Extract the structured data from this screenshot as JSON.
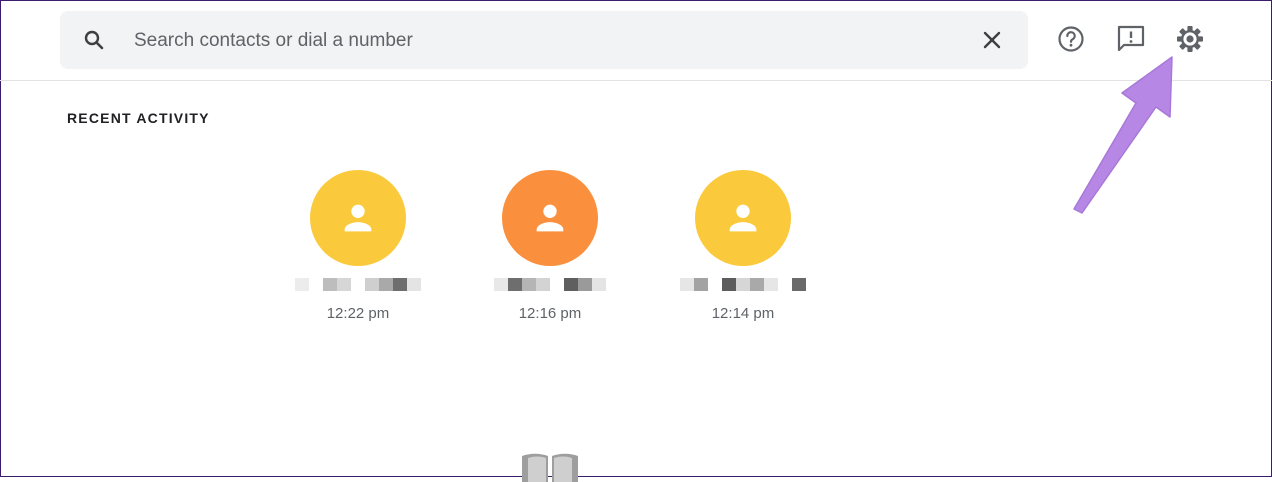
{
  "search": {
    "placeholder": "Search contacts or dial a number",
    "value": ""
  },
  "header_icons": {
    "help": "help-icon",
    "feedback": "feedback-icon",
    "settings": "gear-icon"
  },
  "recent": {
    "title": "RECENT ACTIVITY",
    "items": [
      {
        "time": "12:22 pm",
        "avatar_color": "#fbc93c",
        "name": "redacted"
      },
      {
        "time": "12:16 pm",
        "avatar_color": "#fa903e",
        "name": "redacted"
      },
      {
        "time": "12:14 pm",
        "avatar_color": "#fbc93c",
        "name": "redacted"
      }
    ]
  },
  "colors": {
    "accent_arrow": "#b787e5",
    "search_bg": "#f1f3f4",
    "icon_gray": "#5f6368"
  }
}
